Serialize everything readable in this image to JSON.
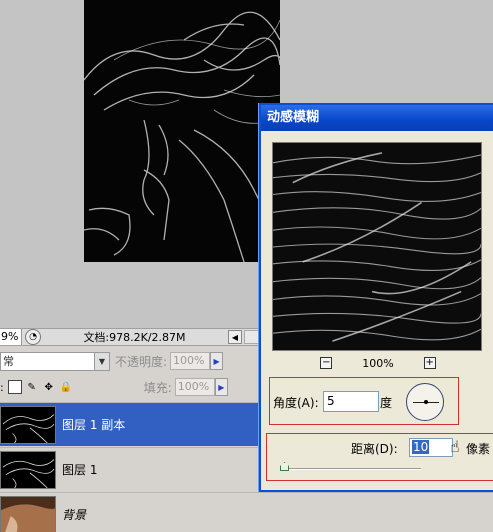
{
  "status": {
    "zoom": "9%",
    "doc_size": "文档:978.2K/2.87M",
    "scroll_left": "◀"
  },
  "layers": {
    "blend_mode": "常",
    "opacity_label": "不透明度:",
    "opacity_value": "100%",
    "fill_label": "填充:",
    "fill_value": "100%",
    "lock_label": ":",
    "rows": [
      {
        "name": "图层 1 副本",
        "selected": true
      },
      {
        "name": "图层 1",
        "selected": false
      },
      {
        "name": "背景",
        "selected": false
      }
    ]
  },
  "dialog": {
    "title": "动感模糊",
    "zoom_value": "100%",
    "zoom_minus": "−",
    "zoom_plus": "+",
    "angle_label": "角度(A):",
    "angle_value": "5",
    "angle_unit": "度",
    "distance_label": "距离(D):",
    "distance_value": "10",
    "distance_unit": "像素"
  },
  "icons": {
    "arrow": "triangle-right-icon",
    "hand": "hand-cursor-icon"
  },
  "colors": {
    "selection_blue": "#3160c2",
    "dialog_title_blue": "#0746c9",
    "highlight_red": "#d03030"
  }
}
